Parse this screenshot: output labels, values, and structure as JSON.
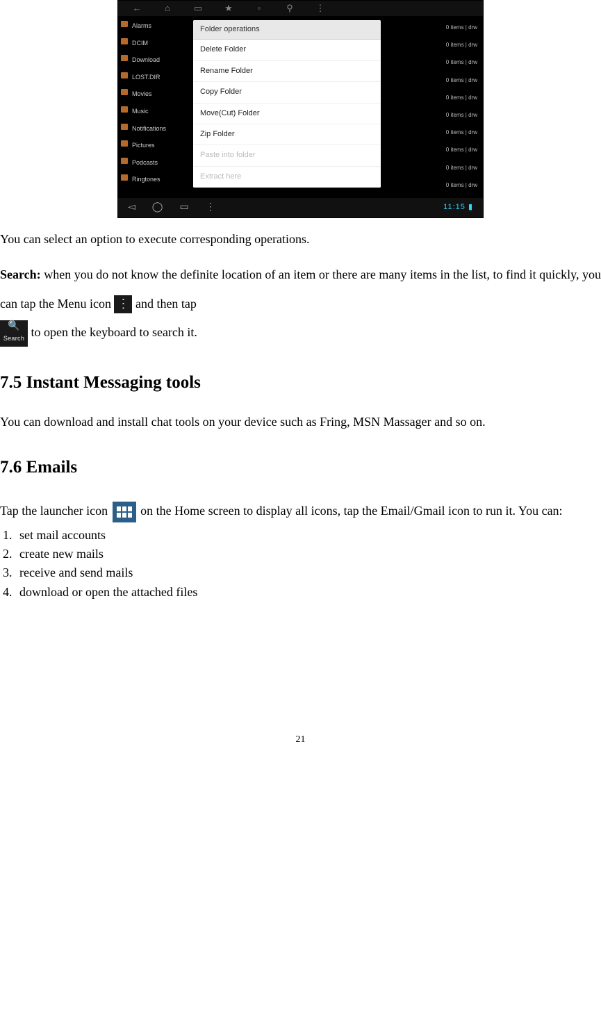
{
  "screenshot": {
    "topIcons": [
      "←",
      "⌂",
      "▭",
      "★",
      "◦",
      "⚲",
      "⋮"
    ],
    "sideItems": [
      "Alarms",
      "DCIM",
      "Download",
      "LOST.DIR",
      "Movies",
      "Music",
      "Notifications",
      "Pictures",
      "Podcasts",
      "Ringtones"
    ],
    "rightLabel": "0 items | drw",
    "rightCount": 10,
    "dialogTitle": "Folder operations",
    "dialogItems": [
      {
        "label": "Delete Folder",
        "disabled": false
      },
      {
        "label": "Rename Folder",
        "disabled": false
      },
      {
        "label": "Copy Folder",
        "disabled": false
      },
      {
        "label": "Move(Cut) Folder",
        "disabled": false
      },
      {
        "label": "Zip Folder",
        "disabled": false
      },
      {
        "label": "Paste into folder",
        "disabled": true
      },
      {
        "label": "Extract here",
        "disabled": true
      }
    ],
    "navTime": "11:15",
    "navGlyphs": [
      "◅",
      "◯",
      "▭",
      "⋮"
    ]
  },
  "para_select": "You can select an option to execute corresponding operations.",
  "search": {
    "label": "Search:",
    "pre": " when you do not know the definite location of an item or there are many items in the list, to find it quickly, you can tap the Menu icon ",
    "mid": " and then tap ",
    "post": " to open the keyboard to search it.",
    "searchLabel": "Search"
  },
  "sec75_title": "7.5 Instant Messaging tools",
  "sec75_body": "You can download and install chat tools on your device such as Fring, MSN Massager and so on.",
  "sec76_title": "7.6 Emails",
  "emails": {
    "pre": "Tap the launcher icon ",
    "post": " on the Home screen to display all icons, tap the Email/Gmail icon to run it. You can:",
    "items": [
      "set mail accounts",
      "create new mails",
      "receive and send mails",
      "download or open the attached files"
    ]
  },
  "pageNumber": "21"
}
